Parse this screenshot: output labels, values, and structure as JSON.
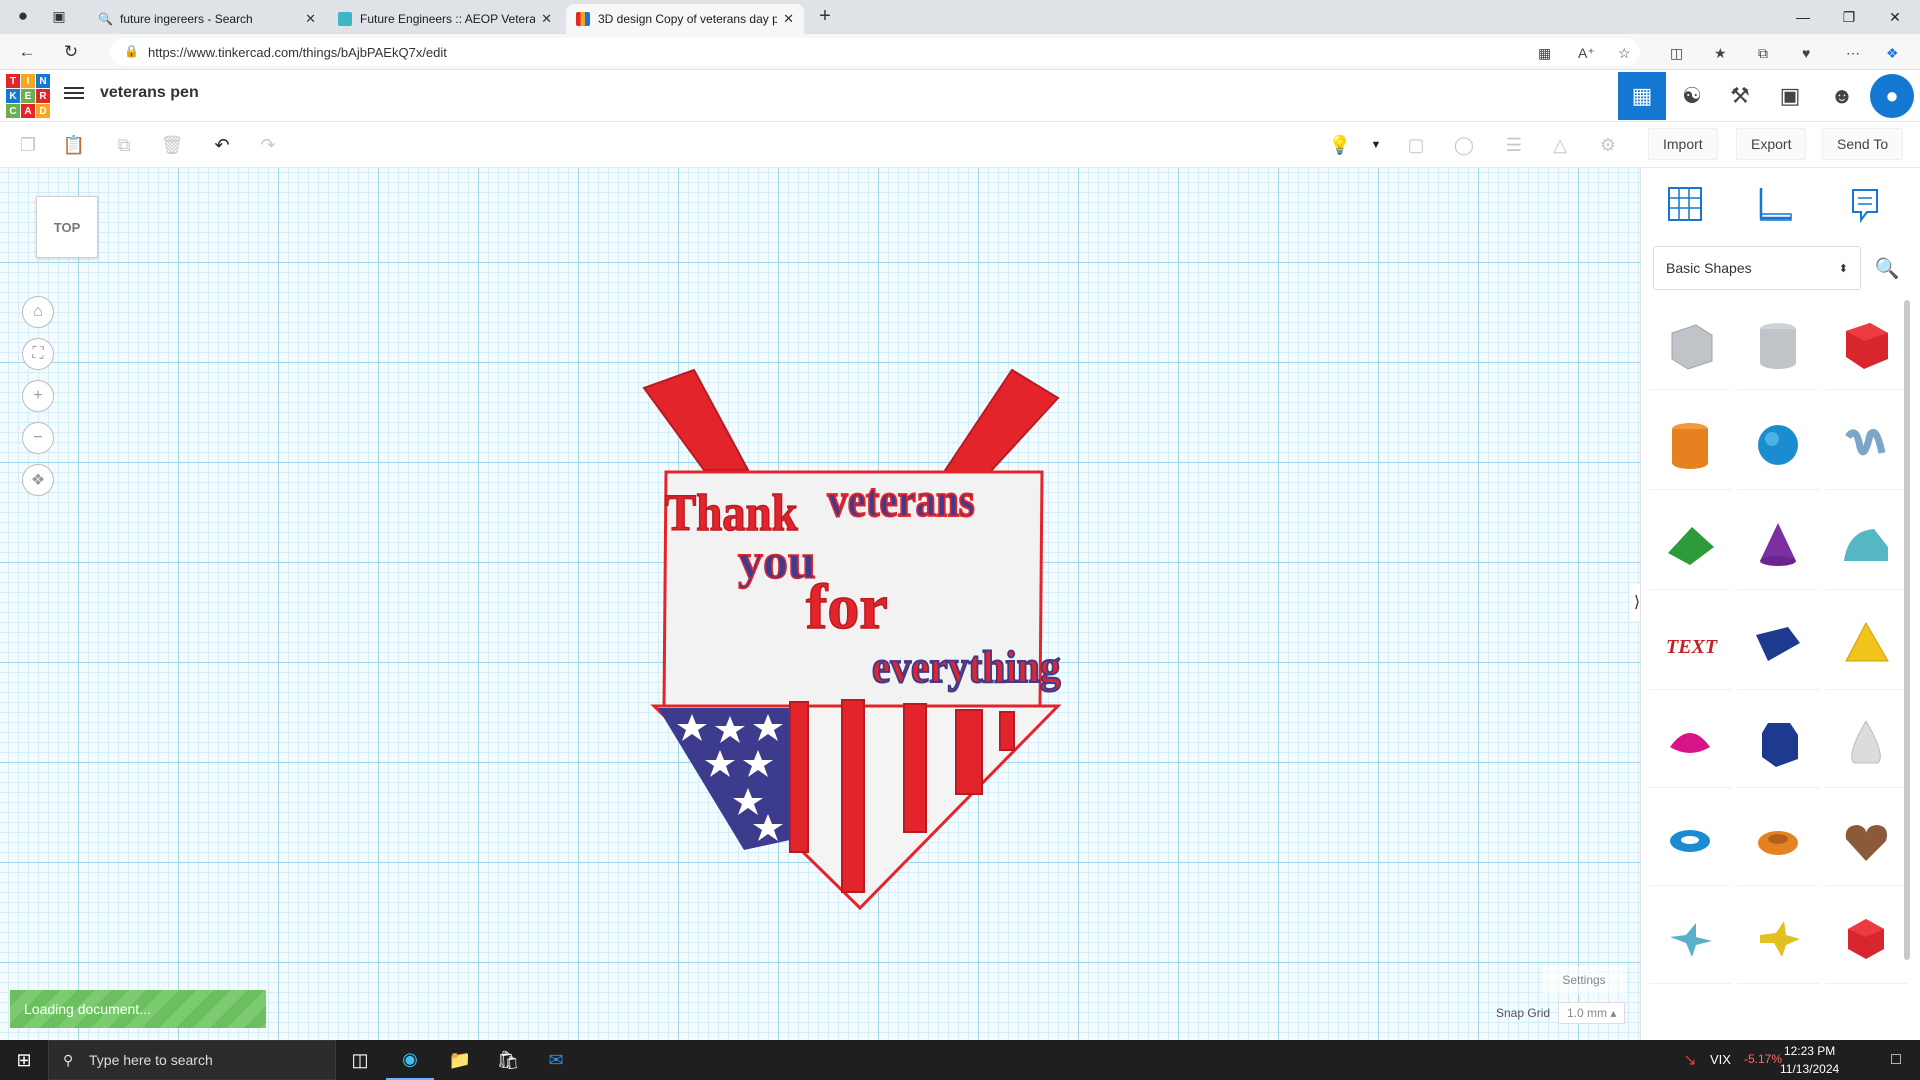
{
  "browser": {
    "tabs": [
      {
        "title": "future ingereers - Search",
        "favicon": "search-icon"
      },
      {
        "title": "Future Engineers :: AEOP Veterans",
        "favicon": "future-engineers-icon"
      },
      {
        "title": "3D design Copy of veterans day p",
        "favicon": "tinkercad-icon"
      }
    ],
    "url": "https://www.tinkercad.com/things/bAjbPAEkQ7x/edit"
  },
  "app": {
    "logo_letters": [
      "T",
      "I",
      "N",
      "K",
      "E",
      "R",
      "C",
      "A",
      "D"
    ],
    "doc_title": "veterans pen",
    "toolbar": {
      "import_label": "Import",
      "export_label": "Export",
      "send_to_label": "Send To"
    },
    "viewcube_label": "TOP",
    "loading_text": "Loading document...",
    "settings_label": "Settings",
    "snap_grid_label": "Snap Grid",
    "snap_grid_value": "1.0 mm"
  },
  "panel": {
    "category": "Basic Shapes"
  },
  "design": {
    "words": [
      "Thank",
      "veterans",
      "you",
      "for",
      "everything"
    ]
  },
  "taskbar": {
    "search_placeholder": "Type here to search",
    "ticker_symbol": "VIX",
    "ticker_change": "-5.17%",
    "time": "12:23 PM",
    "date": "11/13/2024"
  },
  "colors": {
    "accent": "#1477d1",
    "design_red": "#e3242b",
    "design_blue": "#3c3b8e"
  }
}
